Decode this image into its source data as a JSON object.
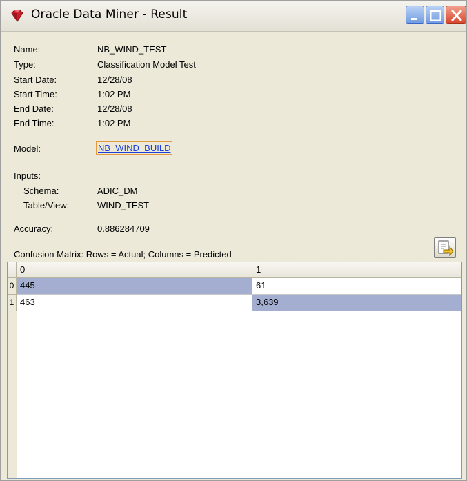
{
  "window": {
    "title": "Oracle Data Miner - Result"
  },
  "details": {
    "name_label": "Name:",
    "name_value": "NB_WIND_TEST",
    "type_label": "Type:",
    "type_value": "Classification Model Test",
    "start_date_label": "Start Date:",
    "start_date_value": "12/28/08",
    "start_time_label": "Start Time:",
    "start_time_value": "1:02 PM",
    "end_date_label": "End Date:",
    "end_date_value": "12/28/08",
    "end_time_label": "End Time:",
    "end_time_value": "1:02 PM",
    "model_label": "Model:",
    "model_link": "NB_WIND_BUILD",
    "inputs_label": "Inputs:",
    "schema_label": "Schema:",
    "schema_value": "ADIC_DM",
    "table_view_label": "Table/View:",
    "table_view_value": "WIND_TEST",
    "accuracy_label": "Accuracy:",
    "accuracy_value": "0.886284709"
  },
  "confusion_matrix": {
    "caption": "Confusion Matrix:   Rows = Actual; Columns = Predicted",
    "column_headers": [
      "0",
      "1"
    ],
    "row_headers": [
      "0",
      "1"
    ],
    "rows": [
      [
        "445",
        "61"
      ],
      [
        "463",
        "3,639"
      ]
    ],
    "diagonal_color": "#a3aed0"
  },
  "icons": {
    "app_icon": "oracle-diamond-icon",
    "export_icon": "export-icon"
  }
}
